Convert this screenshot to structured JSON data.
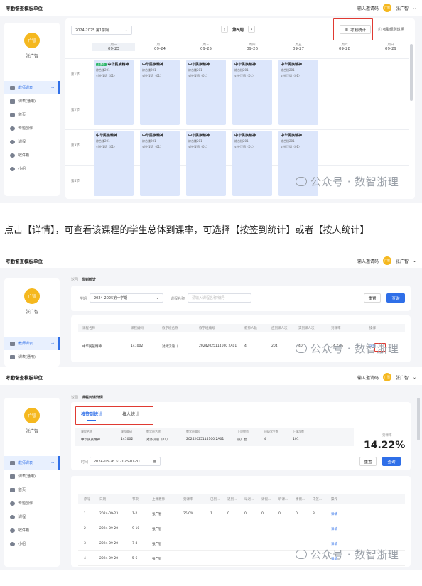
{
  "app_title": "考勤督查模板单位",
  "topbar": {
    "invite": "输入邀请码",
    "avatar": "广智",
    "user": "张广智",
    "caret": "⌄"
  },
  "profile": {
    "avatar": "广智",
    "name": "张广智"
  },
  "nav": [
    {
      "label": "教师课表",
      "icon": "calendar-icon"
    },
    {
      "label": "课表(通用)",
      "icon": "table-icon"
    },
    {
      "label": "首页",
      "icon": "home-icon"
    },
    {
      "label": "专题创作",
      "icon": "tools-icon"
    },
    {
      "label": "课程",
      "icon": "book-icon"
    },
    {
      "label": "收件箱",
      "icon": "inbox-icon"
    },
    {
      "label": "小组",
      "icon": "user-icon"
    }
  ],
  "schedule": {
    "semester": "2024-2025 第1学期",
    "week": "第5周",
    "prev": "‹",
    "next": "›",
    "stats_button": "考勤统计",
    "rule_link": "考勤规则说明",
    "days": [
      {
        "weekday": "周一",
        "date": "09-23"
      },
      {
        "weekday": "周二",
        "date": "09-24"
      },
      {
        "weekday": "周三",
        "date": "09-25"
      },
      {
        "weekday": "周四",
        "date": "09-26"
      },
      {
        "weekday": "周五",
        "date": "09-27"
      },
      {
        "weekday": "周六",
        "date": "09-28"
      },
      {
        "weekday": "周日",
        "date": "09-29"
      }
    ],
    "periods": [
      "第1节",
      "第2节",
      "第3节",
      "第4节"
    ],
    "course": {
      "title": "中华民族精神",
      "tag": "上课中",
      "room": "综合楼201",
      "class": "对外汉语（01）"
    }
  },
  "watermark": "公众号 · 数智浙理",
  "instruction": "点击【详情】，可查看该课程的学生总体到课率，可选择【按签到统计】或者【按人统计】",
  "stats_page": {
    "back": "返回",
    "title": "签到统计",
    "semester_label": "学期",
    "semester": "2024-2025第一学期",
    "course_label": "课程名称",
    "course_placeholder": "请输入课程名称/编号",
    "reset": "重置",
    "query": "查询",
    "headers": [
      "课程名称",
      "课程编码",
      "教学班名称",
      "教学班编号",
      "教师人数",
      "应到课人次",
      "实到课人次",
      "到课率",
      "操作"
    ],
    "row": [
      "中华民族精神",
      "141002",
      "对外汉语（...",
      "20242025114100 2A01",
      "4",
      "204",
      "40",
      "14.22%",
      "详情"
    ]
  },
  "detail_page": {
    "back": "返回",
    "title": "课程到课详情",
    "tabs": [
      "按签到统计",
      "按人统计"
    ],
    "info_headers": [
      "课程名称",
      "课程编码",
      "教学班名称",
      "教学班编号",
      "上课教师",
      "班级学生数",
      "上课次数"
    ],
    "info_values": [
      "中华民族精神",
      "141002",
      "对外汉语（01）",
      "20242025114100 2A01",
      "张广智",
      "4",
      "101"
    ],
    "rate_label": "到课率",
    "rate": "14.22%",
    "time_label": "时间",
    "time_range": "2024-08-26 ~ 2025-01-31",
    "reset": "重置",
    "query": "查询",
    "headers": [
      "序号",
      "日期",
      "节次",
      "上课教师",
      "到课率",
      "已到...",
      "迟到...",
      "早退...",
      "请假...",
      "旷课...",
      "事假...",
      "未签...",
      "操作"
    ],
    "rows": [
      [
        "1",
        "2024-09-23",
        "1-2",
        "张广智",
        "25.0%",
        "1",
        "0",
        "0",
        "0",
        "0",
        "0",
        "3",
        "详情"
      ],
      [
        "2",
        "2024-09-20",
        "9-10",
        "张广智",
        "-",
        "-",
        "-",
        "-",
        "-",
        "-",
        "-",
        "-",
        "详情"
      ],
      [
        "3",
        "2024-09-20",
        "7-8",
        "张广智",
        "-",
        "-",
        "-",
        "-",
        "-",
        "-",
        "-",
        "-",
        "详情"
      ],
      [
        "4",
        "2024-09-20",
        "5-6",
        "张广智",
        "-",
        "-",
        "-",
        "-",
        "-",
        "-",
        "-",
        "-",
        "详情"
      ]
    ]
  },
  "colors": {
    "accent": "#2f6fe8",
    "highlight": "#e03a32",
    "avatar": "#f5b81f"
  }
}
